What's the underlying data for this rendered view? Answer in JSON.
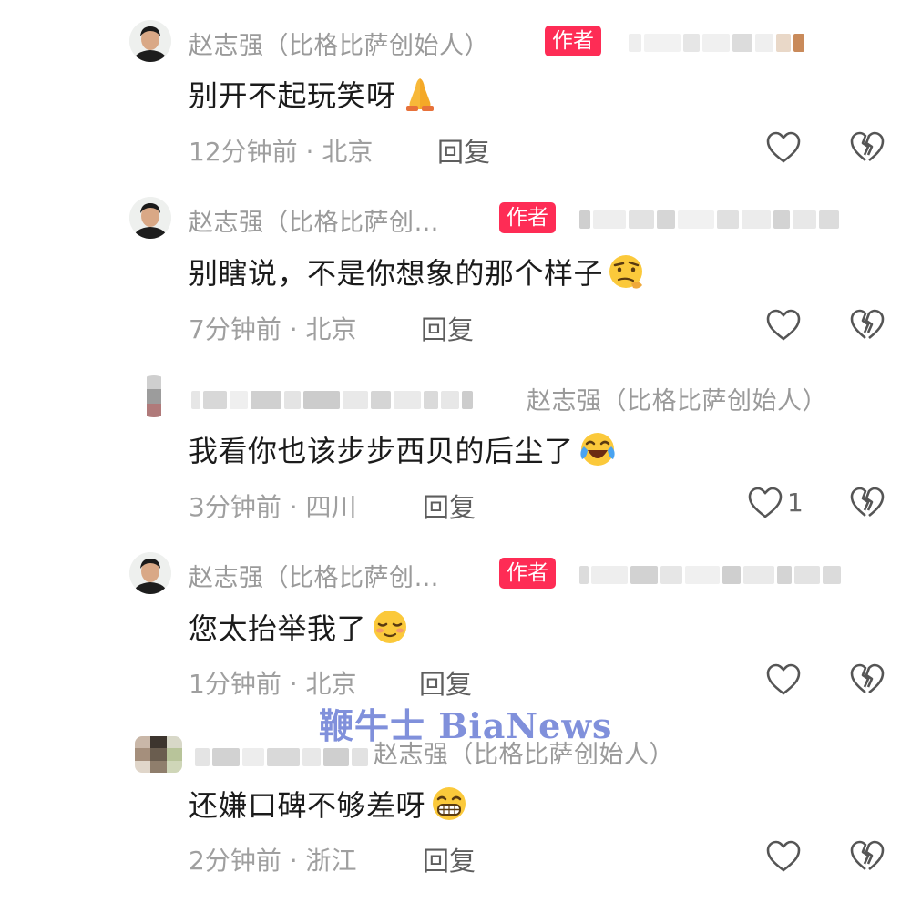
{
  "comments": [
    {
      "author": "赵志强（比格比萨创始人）",
      "badge": "作者",
      "text": "别开不起玩笑呀",
      "emoji": "pray-emoji",
      "time": "12分钟前 · 北京",
      "reply": "回复",
      "like_count": ""
    },
    {
      "author": "赵志强（比格比萨创…",
      "badge": "作者",
      "text": "别瞎说，不是你想象的那个样子",
      "emoji": "thinking-emoji",
      "time": "7分钟前 · 北京",
      "reply": "回复",
      "like_count": ""
    },
    {
      "reply_to": "赵志强（比格比萨创始人）",
      "text": "我看你也该步步西贝的后尘了",
      "emoji": "laugh-cry-emoji",
      "time": "3分钟前 · 四川",
      "reply": "回复",
      "like_count": "1"
    },
    {
      "author": "赵志强（比格比萨创…",
      "badge": "作者",
      "text": "您太抬举我了",
      "emoji": "shy-smile-emoji",
      "time": "1分钟前 · 北京",
      "reply": "回复",
      "like_count": ""
    },
    {
      "reply_to": "赵志强（比格比萨创始人）",
      "text": "还嫌口碑不够差呀",
      "emoji": "grin-emoji",
      "time": "2分钟前 · 浙江",
      "reply": "回复",
      "like_count": ""
    }
  ],
  "watermark": "鞭牛士 BiaNews",
  "icons": {
    "like": "heart-outline-icon",
    "dislike": "broken-heart-icon"
  },
  "colors": {
    "badge": "#fe2c55",
    "name": "#9a9a9a",
    "text": "#1b1b1b",
    "meta": "#9f9f9f"
  }
}
